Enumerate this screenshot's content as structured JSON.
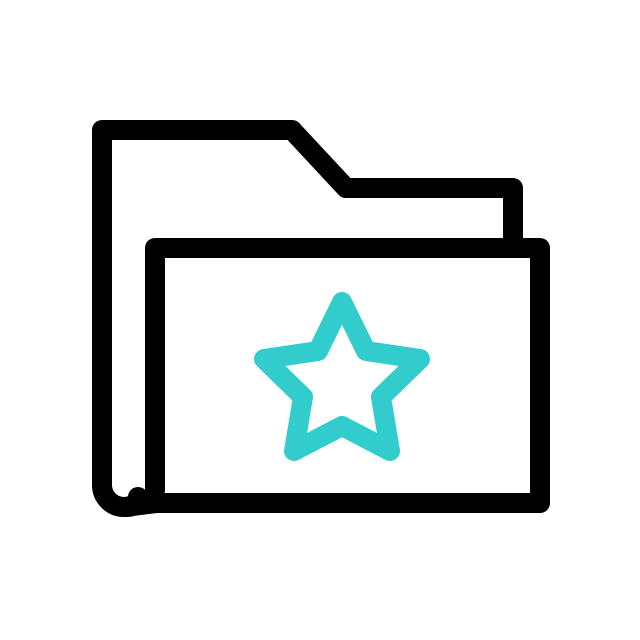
{
  "icon": {
    "name": "favorite-folder-icon",
    "parts": [
      {
        "name": "folder-back-icon",
        "color": "#000000"
      },
      {
        "name": "folder-front-icon",
        "color": "#000000"
      },
      {
        "name": "star-icon",
        "color": "#33CCCC"
      }
    ],
    "background": "#FFFFFF"
  }
}
